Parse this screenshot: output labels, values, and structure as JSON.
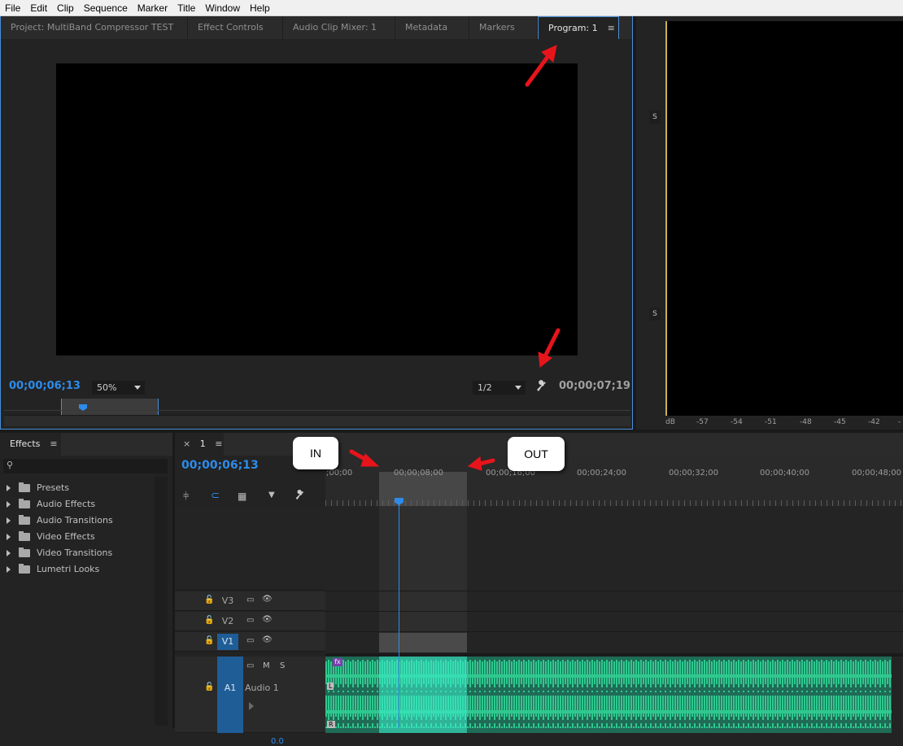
{
  "menubar": [
    "File",
    "Edit",
    "Clip",
    "Sequence",
    "Marker",
    "Title",
    "Window",
    "Help"
  ],
  "top_tabs": [
    {
      "label": "Project: MultiBand Compressor TEST",
      "active": false
    },
    {
      "label": "Effect Controls",
      "active": false
    },
    {
      "label": "Audio Clip Mixer: 1",
      "active": false
    },
    {
      "label": "Metadata",
      "active": false
    },
    {
      "label": "Markers",
      "active": false
    },
    {
      "label": "Program: 1",
      "active": true
    }
  ],
  "panel_menu_glyph": "≡",
  "program": {
    "current_timecode": "00;00;06;13",
    "zoom": "50%",
    "resolution": "1/2",
    "duration_timecode": "00;00;07;19"
  },
  "meters": {
    "solo_labels": [
      "S",
      "S"
    ],
    "db_scale": [
      "dB",
      "-57",
      "-54",
      "-51",
      "-48",
      "-45",
      "-42",
      "-"
    ]
  },
  "effects": {
    "tab_label": "Effects",
    "search_placeholder": "",
    "items": [
      "Presets",
      "Audio Effects",
      "Audio Transitions",
      "Video Effects",
      "Video Transitions",
      "Lumetri Looks"
    ]
  },
  "timeline": {
    "tab_close": "×",
    "tab_label": "1",
    "timecode": "00;00;06;13",
    "ruler_labels": [
      ";00;00",
      "00;00;08;00",
      "00;00;16;00",
      "00;00;24;00",
      "00;00;32;00",
      "00;00;40;00",
      "00;00;48;00"
    ],
    "video_tracks": [
      "V3",
      "V2",
      "V1"
    ],
    "audio_track": {
      "id": "A1",
      "name": "Audio 1",
      "m": "M",
      "s": "S",
      "fx": "fx",
      "ch_left": "L",
      "ch_right": "R"
    },
    "master_level": "0.0"
  },
  "annotations": {
    "in_label": "IN",
    "out_label": "OUT",
    "arrow_color": "#e8141b"
  },
  "colors": {
    "accent_blue": "#2d8ceb",
    "waveform": "#2fc88f",
    "waveform_highlight": "#3df0d0",
    "selection_border": "#4a8fd6"
  }
}
